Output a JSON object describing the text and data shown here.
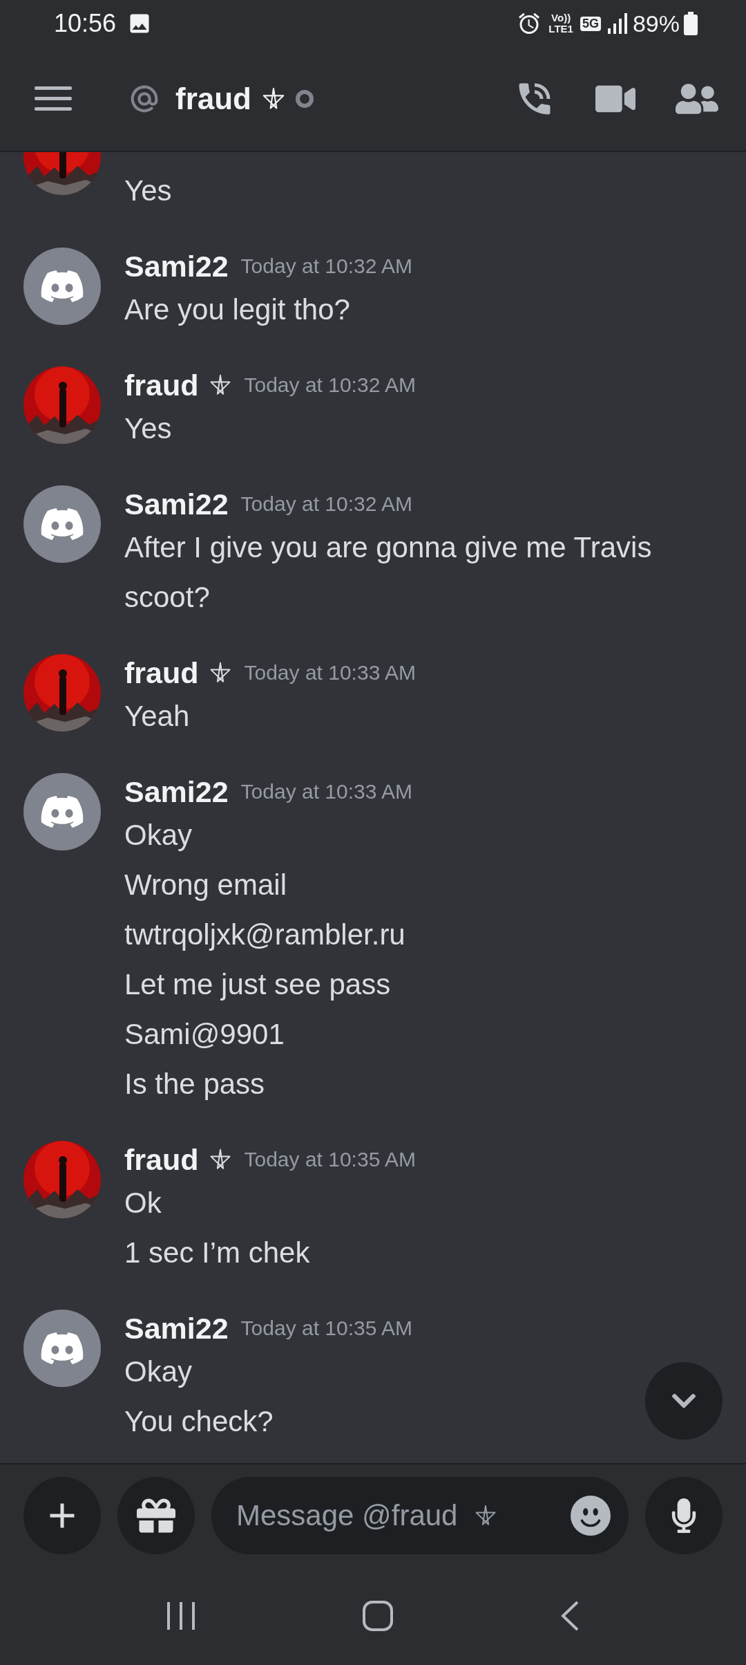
{
  "status_bar": {
    "time": "10:56",
    "volte": "Vo))",
    "lte": "LTE1",
    "network": "5G",
    "battery": "89%"
  },
  "header": {
    "title": "fraud",
    "title_badge": true,
    "online": false
  },
  "messages": [
    {
      "kind": "picture",
      "lines": [
        "Yes"
      ]
    },
    {
      "kind": "default",
      "author": "Sami22",
      "badge": false,
      "time": "Today at 10:32 AM",
      "lines": [
        "Are you legit tho?"
      ]
    },
    {
      "kind": "picture",
      "author": "fraud",
      "badge": true,
      "time": "Today at 10:32 AM",
      "lines": [
        "Yes"
      ]
    },
    {
      "kind": "default",
      "author": "Sami22",
      "badge": false,
      "time": "Today at 10:32 AM",
      "lines": [
        "After I give you are gonna give me Travis scoot?"
      ]
    },
    {
      "kind": "picture",
      "author": "fraud",
      "badge": true,
      "time": "Today at 10:33 AM",
      "lines": [
        "Yeah"
      ]
    },
    {
      "kind": "default",
      "author": "Sami22",
      "badge": false,
      "time": "Today at 10:33 AM",
      "lines": [
        "Okay",
        "Wrong email",
        "twtrqoljxk@rambler.ru",
        "Let me just see pass",
        "Sami@9901",
        "Is the pass"
      ]
    },
    {
      "kind": "picture",
      "author": "fraud",
      "badge": true,
      "time": "Today at 10:35 AM",
      "lines": [
        "Ok",
        "1 sec I’m chek"
      ]
    },
    {
      "kind": "default",
      "author": "Sami22",
      "badge": false,
      "time": "Today at 10:35 AM",
      "lines": [
        "Okay",
        "You check?"
      ]
    }
  ],
  "composer": {
    "placeholder": "Message @fraud",
    "placeholder_badge": true
  }
}
